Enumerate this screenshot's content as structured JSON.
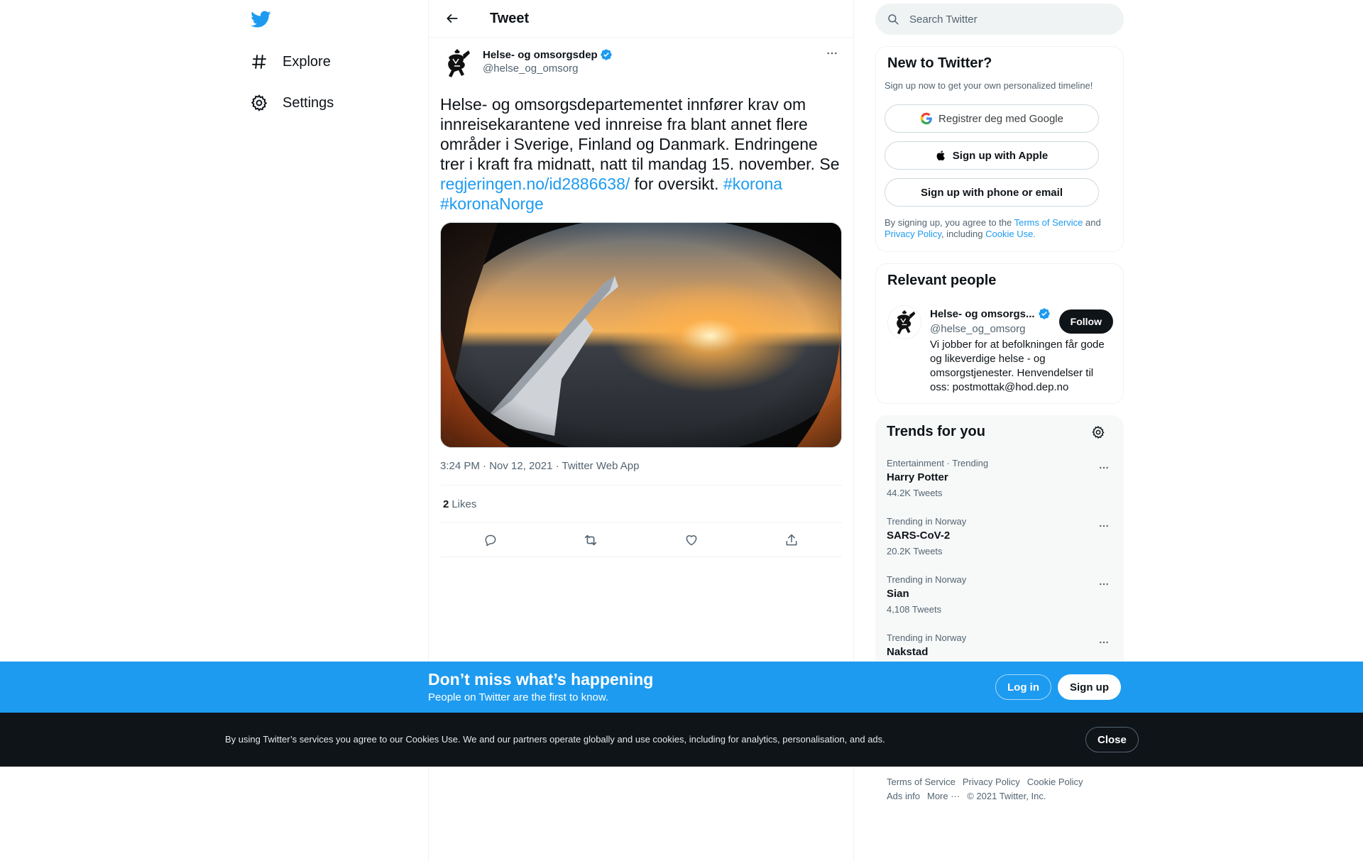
{
  "nav": {
    "logo_icon": "twitter-bird-icon",
    "items": [
      {
        "label": "Explore",
        "icon": "hashtag-icon"
      },
      {
        "label": "Settings",
        "icon": "gear-icon"
      }
    ]
  },
  "header": {
    "title": "Tweet"
  },
  "tweet": {
    "author_name": "Helse- og omsorgsdep",
    "author_handle": "@helse_og_omsorg",
    "text_1": "Helse- og omsorgsdepartementet innfører krav om innreisekarantene ved innreise fra blant annet flere områder i Sverige, Finland og Danmark. Endringene trer i kraft fra midnatt, natt til mandag 15. november. Se ",
    "link": "regjeringen.no/id2886638/",
    "text_2": " for oversikt. ",
    "hashtag_1": "#korona",
    "hashtag_2": "#koronaNorge",
    "time": "3:24 PM · Nov 12, 2021",
    "separator": " · ",
    "source": "Twitter Web App",
    "likes_count": "2",
    "likes_label": "Likes"
  },
  "search": {
    "placeholder": "Search Twitter"
  },
  "new_to_twitter": {
    "title": "New to Twitter?",
    "subtitle": "Sign up now to get your own personalized timeline!",
    "google_btn": "Registrer deg med Google",
    "apple_btn": "Sign up with Apple",
    "phone_btn": "Sign up with phone or email",
    "legal_1": "By signing up, you agree to the ",
    "legal_tos": "Terms of Service",
    "legal_2": " and ",
    "legal_privacy": "Privacy Policy",
    "legal_3": ", including ",
    "legal_cookie": "Cookie Use."
  },
  "relevant_people": {
    "title": "Relevant people",
    "name": "Helse- og omsorgs...",
    "handle": "@helse_og_omsorg",
    "follow": "Follow",
    "bio": "Vi jobber for at befolkningen får gode og likeverdige helse - og omsorgstjenester. Henvendelser til oss: postmottak@hod.dep.no"
  },
  "trends": {
    "title": "Trends for you",
    "items": [
      {
        "context": "Entertainment · Trending",
        "name": "Harry Potter",
        "count": "44.2K Tweets"
      },
      {
        "context": "Trending in Norway",
        "name": "SARS-CoV-2",
        "count": "20.2K Tweets"
      },
      {
        "context": "Trending in Norway",
        "name": "Sian",
        "count": "4,108 Tweets"
      },
      {
        "context": "Trending in Norway",
        "name": "Nakstad",
        "count": ""
      }
    ]
  },
  "footer": {
    "tos": "Terms of Service",
    "privacy": "Privacy Policy",
    "cookie": "Cookie Policy",
    "ads": "Ads info",
    "more": "More ···",
    "copyright": "© 2021 Twitter, Inc."
  },
  "banner": {
    "title": "Don’t miss what’s happening",
    "subtitle": "People on Twitter are the first to know.",
    "login": "Log in",
    "signup": "Sign up"
  },
  "cookie_bar": {
    "text": "By using Twitter’s services you agree to our Cookies Use. We and our partners operate globally and use cookies, including for analytics, personalisation, and ads.",
    "close": "Close"
  },
  "colors": {
    "accent": "#1d9bf0",
    "text": "#0f1419",
    "secondary": "#536471",
    "dark": "#0f1419"
  }
}
